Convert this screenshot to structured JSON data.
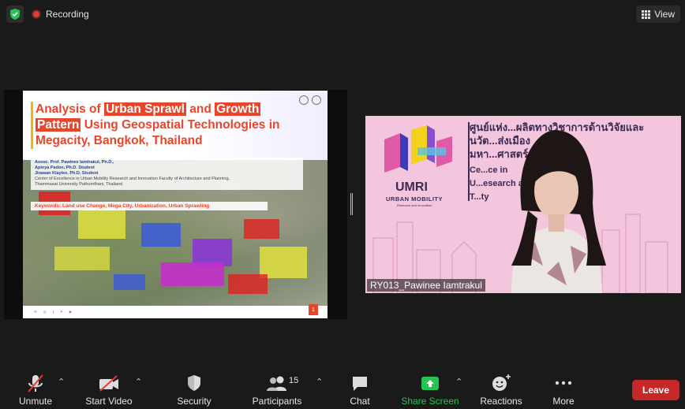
{
  "top": {
    "recording_label": "Recording",
    "view_label": "View"
  },
  "slide": {
    "title_parts": [
      "Analysis of ",
      "Urban Sprawl",
      " and ",
      "Growth",
      "Pattern",
      " Using Geospatial Technologies in Megacity, Bangkok, Thailand"
    ],
    "authors": [
      "Assoc. Prof. Pawinee Iamtrakul, Ph.D.,",
      "Apinya Padon, Ph.D. Student",
      "Jirawan Klaylee, Ph.D. Student"
    ],
    "affiliation": [
      "Center of Excellence in Urban Mobility Research and Innovation Faculty of Architecture and Planning,",
      "Thammasat University Pathumthani, Thailand"
    ],
    "keywords": "Keywords: Land use Change, Mega City, Urbanization, Urban Sprawling",
    "page_number": "1",
    "colors": {
      "accent": "#e8462b",
      "highlight": "#f5b400"
    }
  },
  "video": {
    "participant_name": "RY013_Pawinee Iamtrakul",
    "org_short": "UMRI",
    "org_sub": "URBAN MOBILITY",
    "org_sub2": "Research and Innovation",
    "thai_lines": [
      "ศูนย์แห่ง...ผลิตทางวิชาการด้านวิจัยและ",
      "นวัต...ส่งเมือง",
      "มหา...ศาสตร์"
    ],
    "en_lines": [
      "Ce...ce in",
      "U...esearch and Innovation",
      "T...ty"
    ]
  },
  "toolbar": {
    "unmute": "Unmute",
    "start_video": "Start Video",
    "security": "Security",
    "participants": "Participants",
    "participants_count": "15",
    "chat": "Chat",
    "share_screen": "Share Screen",
    "reactions": "Reactions",
    "more": "More",
    "leave": "Leave",
    "colors": {
      "share_green": "#23c552",
      "leave_red": "#c62828"
    }
  }
}
